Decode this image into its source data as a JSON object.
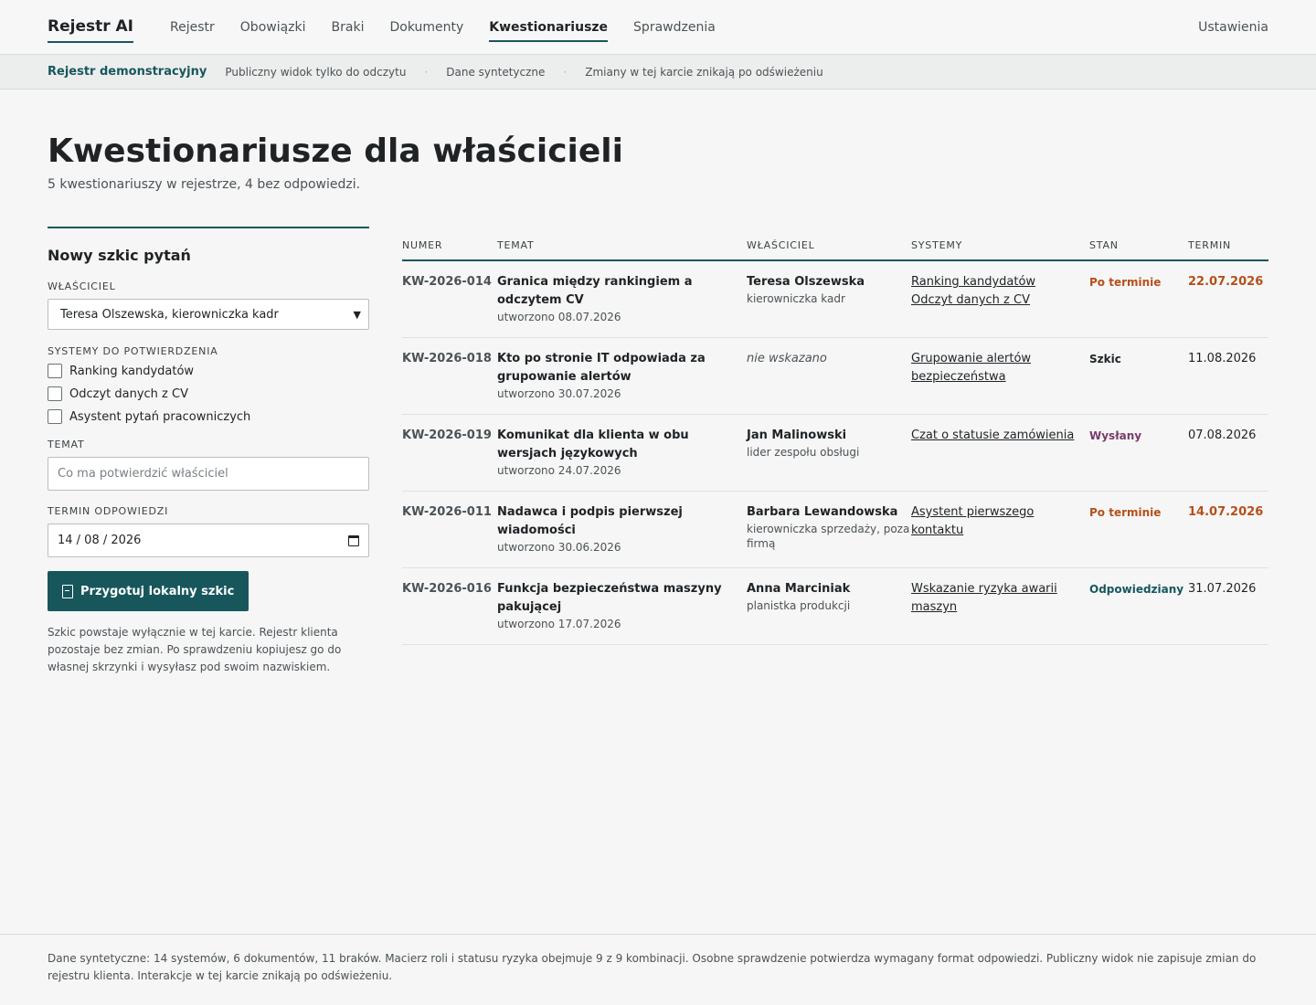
{
  "nav": {
    "brand": "Rejestr AI",
    "links": [
      {
        "label": "Rejestr"
      },
      {
        "label": "Obowiązki"
      },
      {
        "label": "Braki"
      },
      {
        "label": "Dokumenty"
      },
      {
        "label": "Kwestionariusze"
      },
      {
        "label": "Sprawdzenia"
      }
    ],
    "active_index": 4,
    "settings": "Ustawienia"
  },
  "banner": {
    "title": "Rejestr demonstracyjny",
    "items": [
      "Publiczny widok tylko do odczytu",
      "Dane syntetyczne",
      "Zmiany w tej karcie znikają po odświeżeniu"
    ],
    "separator": "·"
  },
  "page": {
    "title": "Kwestionariusze dla właścicieli",
    "subtitle": "5 kwestionariuszy w rejestrze, 4 bez odpowiedzi."
  },
  "form": {
    "title": "Nowy szkic pytań",
    "owner_label": "WŁAŚCICIEL",
    "owner_value": "Teresa Olszewska, kierowniczka kadr",
    "systems_label": "SYSTEMY DO POTWIERDZENIA",
    "systems": [
      "Ranking kandydatów",
      "Odczyt danych z CV",
      "Asystent pytań pracowniczych"
    ],
    "topic_label": "TEMAT",
    "topic_placeholder": "Co ma potwierdzić właściciel",
    "deadline_label": "TERMIN ODPOWIEDZI",
    "deadline_value": "14 / 08 / 2026",
    "button": "Przygotuj lokalny szkic",
    "note": "Szkic powstaje wyłącznie w tej karcie. Rejestr klienta pozostaje bez zmian. Po sprawdzeniu kopiujesz go do własnej skrzynki i wysyłasz pod swoim nazwiskiem."
  },
  "table": {
    "headers": [
      "NUMER",
      "TEMAT",
      "WŁAŚCICIEL",
      "SYSTEMY",
      "STAN",
      "TERMIN"
    ],
    "rows": [
      {
        "num": "KW-2026-014",
        "topic": "Granica między rankingiem a odczytem CV",
        "created": "utworzono 08.07.2026",
        "owner": "Teresa Olszewska",
        "role": "kierowniczka kadr",
        "systems": [
          "Ranking kandydatów",
          "Odczyt danych z CV"
        ],
        "status": "Po terminie",
        "deadline": "22.07.2026"
      },
      {
        "num": "KW-2026-018",
        "topic": "Kto po stronie IT odpowiada za grupowanie alertów",
        "created": "utworzono 30.07.2026",
        "owner": "nie wskazano",
        "role": "",
        "systems": [
          "Grupowanie alertów bezpieczeństwa"
        ],
        "status": "Szkic",
        "deadline": "11.08.2026"
      },
      {
        "num": "KW-2026-019",
        "topic": "Komunikat dla klienta w obu wersjach językowych",
        "created": "utworzono 24.07.2026",
        "owner": "Jan Malinowski",
        "role": "lider zespołu obsługi",
        "systems": [
          "Czat o statusie zamówienia"
        ],
        "status": "Wysłany",
        "deadline": "07.08.2026"
      },
      {
        "num": "KW-2026-011",
        "topic": "Nadawca i podpis pierwszej wiadomości",
        "created": "utworzono 30.06.2026",
        "owner": "Barbara Lewandowska",
        "role": "kierowniczka sprzedaży, poza firmą",
        "systems": [
          "Asystent pierwszego kontaktu"
        ],
        "status": "Po terminie",
        "deadline": "14.07.2026"
      },
      {
        "num": "KW-2026-016",
        "topic": "Funkcja bezpieczeństwa maszyny pakującej",
        "created": "utworzono 17.07.2026",
        "owner": "Anna Marciniak",
        "role": "planistka produkcji",
        "systems": [
          "Wskazanie ryzyka awarii maszyn"
        ],
        "status": "Odpowiedziany",
        "deadline": "31.07.2026"
      }
    ]
  },
  "status_colors": {
    "Po terminie": "#b5501b",
    "Szkic": "#1f2326",
    "Wysłany": "#7a3b6a",
    "Odpowiedziany": "#17575c"
  },
  "accent_color": "#17575c",
  "footer": "Dane syntetyczne: 14 systemów, 6 dokumentów, 11 braków. Macierz roli i statusu ryzyka obejmuje 9 z 9 kombinacji. Osobne sprawdzenie potwierdza wymagany format odpowiedzi. Publiczny widok nie zapisuje zmian do rejestru klienta. Interakcje w tej karcie znikają po odświeżeniu."
}
